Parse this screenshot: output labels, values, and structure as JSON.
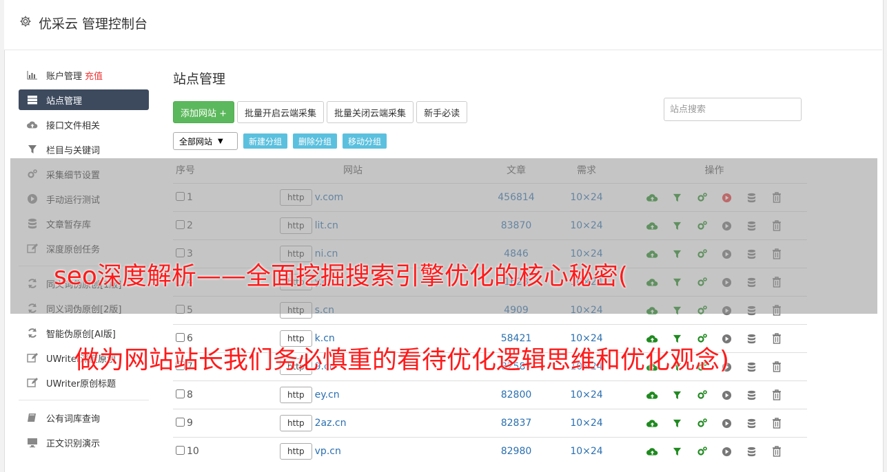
{
  "app": {
    "title": "优采云 管理控制台"
  },
  "sidebar": {
    "items": [
      {
        "label": "账户管理",
        "extra": "充值",
        "icon": "bar-chart-icon",
        "active": false
      },
      {
        "label": "站点管理",
        "icon": "server-icon",
        "active": true
      },
      {
        "label": "接口文件相关",
        "icon": "cloud-upload-icon",
        "active": false
      },
      {
        "label": "栏目与关键词",
        "icon": "filter-icon",
        "active": false
      },
      {
        "label": "采集细节设置",
        "icon": "cogs-icon",
        "active": false
      },
      {
        "label": "手动运行测试",
        "icon": "play-circle-icon",
        "active": false
      },
      {
        "label": "文章暂存库",
        "icon": "database-icon",
        "active": false
      },
      {
        "label": "深度原创任务",
        "icon": "edit-icon",
        "active": false
      }
    ],
    "items2": [
      {
        "label": "同义词伪原创[1版]",
        "icon": "refresh-icon"
      },
      {
        "label": "同义词伪原创[2版]",
        "icon": "refresh-icon"
      },
      {
        "label": "智能伪原创[AI版]",
        "icon": "refresh-icon"
      },
      {
        "label": "UWriter深度原创",
        "icon": "edit-icon"
      },
      {
        "label": "UWriter原创标题",
        "icon": "edit-icon"
      }
    ],
    "items3": [
      {
        "label": "公有词库查询",
        "icon": "book-icon"
      },
      {
        "label": "正文识别演示",
        "icon": "monitor-icon"
      }
    ]
  },
  "main": {
    "title": "站点管理",
    "add_button": "添加网站 +",
    "batch_on": "批量开启云端采集",
    "batch_off": "批量关闭云端采集",
    "newbie": "新手必读",
    "search_placeholder": "站点搜索",
    "group_select": "全部网站",
    "new_group": "新建分组",
    "delete_group": "删除分组",
    "move_group": "移动分组"
  },
  "table": {
    "headers": [
      "序号",
      "网站",
      "文章",
      "需求",
      "操作"
    ],
    "rows": [
      {
        "no": "1",
        "scheme": "http",
        "domain": "v.com",
        "articles": "456814",
        "demand": "10×24",
        "running": true
      },
      {
        "no": "2",
        "scheme": "http",
        "domain": "lit.cn",
        "articles": "83870",
        "demand": "10×24",
        "running": false
      },
      {
        "no": "3",
        "scheme": "http",
        "domain": "ni.cn",
        "articles": "4846",
        "demand": "10×24",
        "running": false
      },
      {
        "no": "4",
        "scheme": "http",
        "domain": "y.cn",
        "articles": "1628",
        "demand": "10×24",
        "running": false
      },
      {
        "no": "5",
        "scheme": "http",
        "domain": "s.cn",
        "articles": "4909",
        "demand": "10×24",
        "running": false
      },
      {
        "no": "6",
        "scheme": "http",
        "domain": "k.cn",
        "articles": "58421",
        "demand": "10×24",
        "running": false
      },
      {
        "no": "7",
        "scheme": "http",
        "domain": "9.cn",
        "articles": "82587",
        "demand": "10×24",
        "running": false
      },
      {
        "no": "8",
        "scheme": "http",
        "domain": "ey.cn",
        "articles": "82800",
        "demand": "10×24",
        "running": false
      },
      {
        "no": "9",
        "scheme": "http",
        "domain": "2az.cn",
        "articles": "82837",
        "demand": "10×24",
        "running": false
      },
      {
        "no": "10",
        "scheme": "http",
        "domain": "vp.cn",
        "articles": "82980",
        "demand": "10×24",
        "running": false
      }
    ]
  },
  "overlay": {
    "line1": "seo深度解析——全面挖掘搜索引擎优化的核心秘密(",
    "line2": "做为网站站长我们务必慎重的看待优化逻辑思维和优化观念)"
  },
  "colors": {
    "green": "#1f8a1f",
    "red": "#e33",
    "accent": "#3d4a5e"
  }
}
